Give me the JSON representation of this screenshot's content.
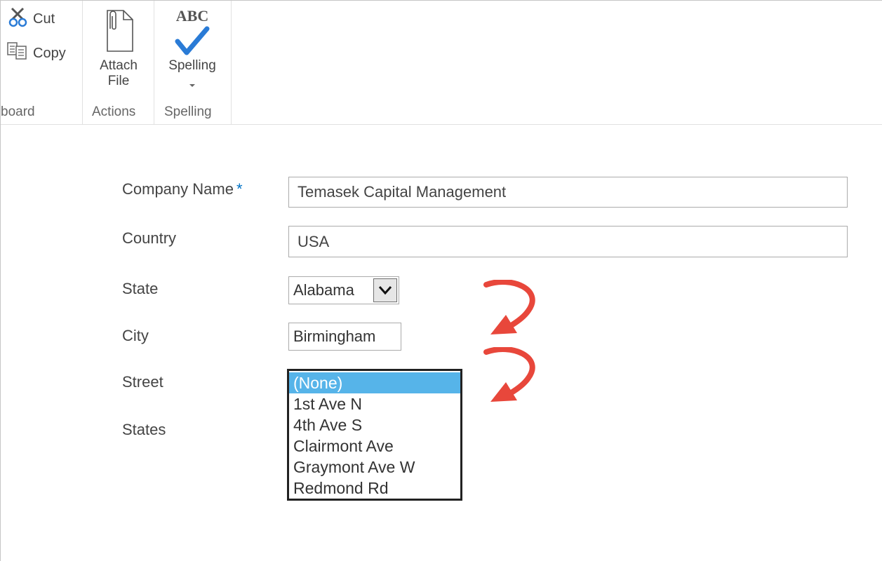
{
  "ribbon": {
    "clipboard": {
      "cut_label": "Cut",
      "copy_label": "Copy",
      "group_label": "board"
    },
    "actions": {
      "attach_label": "Attach\nFile",
      "group_label": "Actions"
    },
    "spelling": {
      "icon_text": "ABC",
      "button_label": "Spelling",
      "group_label": "Spelling"
    }
  },
  "form": {
    "company_name": {
      "label": "Company Name",
      "required_marker": "*",
      "value": "Temasek Capital Management"
    },
    "country": {
      "label": "Country",
      "value": "USA"
    },
    "state": {
      "label": "State",
      "value": "Alabama"
    },
    "city": {
      "label": "City",
      "value": "Birmingham"
    },
    "street": {
      "label": "Street",
      "options": [
        "(None)",
        "1st Ave N",
        "4th Ave S",
        "Clairmont Ave",
        "Graymont Ave W",
        "Redmond Rd"
      ],
      "selected": "(None)"
    },
    "states": {
      "label": "States"
    }
  },
  "colors": {
    "accent_blue": "#0072c6",
    "selection_blue": "#56b4e9",
    "annotation_red": "#e8473b"
  }
}
